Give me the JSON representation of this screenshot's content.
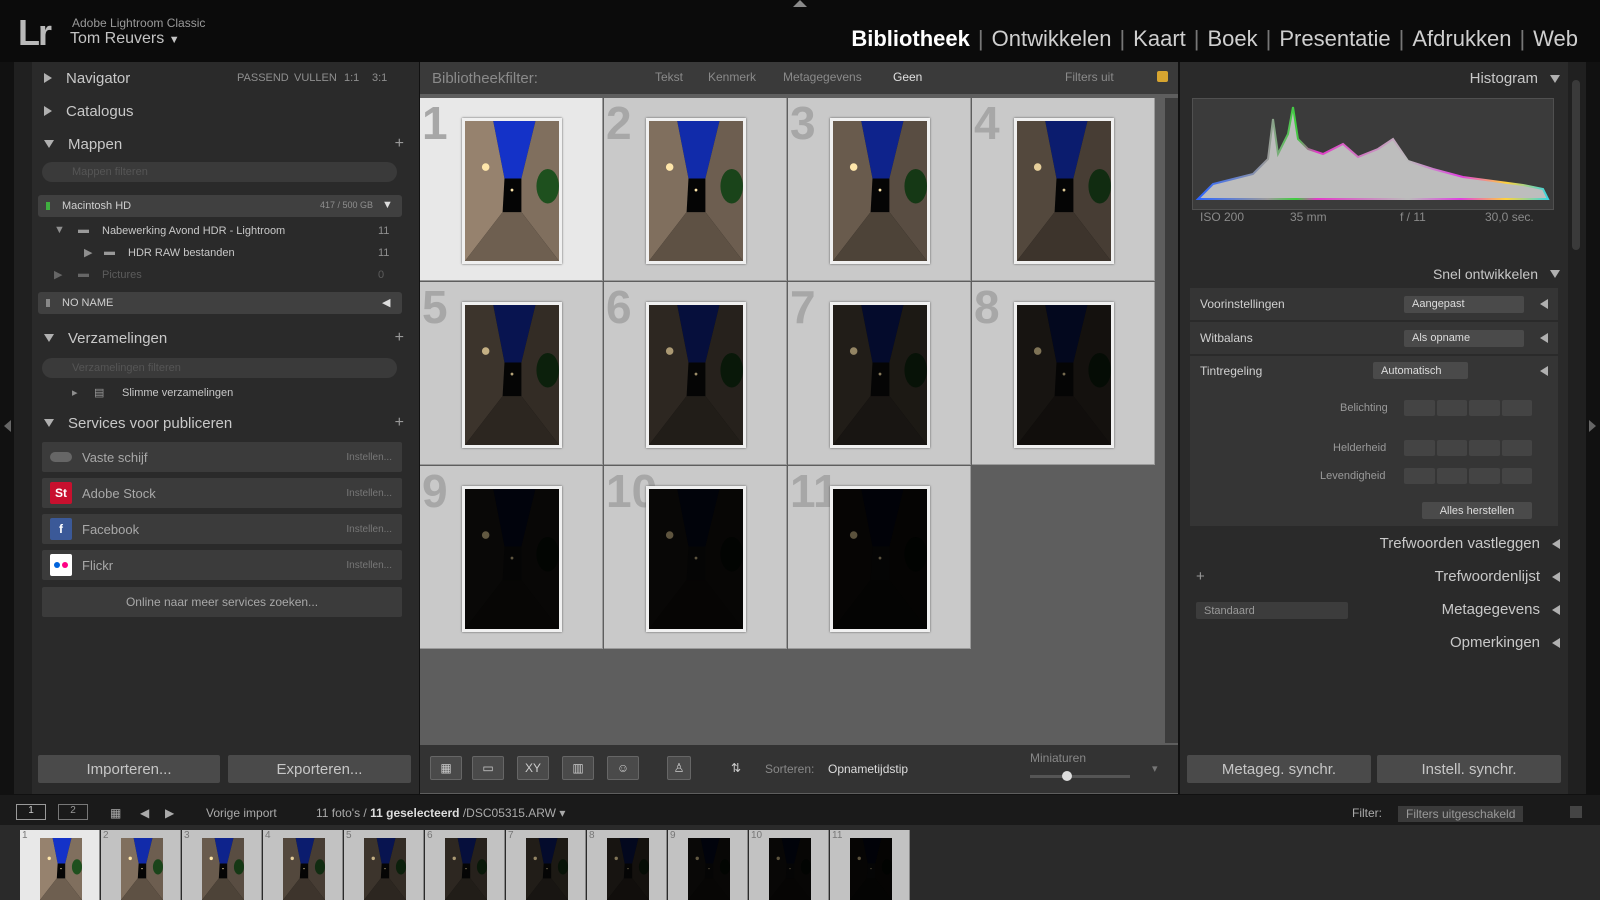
{
  "app": {
    "logo": "Lr",
    "name": "Adobe Lightroom Classic",
    "user": "Tom Reuvers",
    "user_caret": "▼"
  },
  "modules": [
    {
      "label": "Bibliotheek",
      "active": true
    },
    {
      "label": "Ontwikkelen"
    },
    {
      "label": "Kaart"
    },
    {
      "label": "Boek"
    },
    {
      "label": "Presentatie"
    },
    {
      "label": "Afdrukken"
    },
    {
      "label": "Web"
    }
  ],
  "left": {
    "navigator": {
      "label": "Navigator",
      "opts": [
        "PASSEND",
        "VULLEN",
        "1:1",
        "3:1"
      ]
    },
    "catalogus": "Catalogus",
    "mappen": {
      "label": "Mappen",
      "search_placeholder": "Mappen filteren",
      "volume": {
        "name": "Macintosh HD",
        "size": "417 / 500 GB"
      },
      "folders": [
        {
          "name": "Nabewerking Avond HDR - Lightroom",
          "count": "11"
        },
        {
          "name": "HDR RAW bestanden",
          "count": "11"
        },
        {
          "name": "Pictures",
          "count": "0"
        }
      ],
      "no_name": "NO NAME"
    },
    "verzamelingen": {
      "label": "Verzamelingen",
      "search_placeholder": "Verzamelingen filteren",
      "item": "Slimme verzamelingen"
    },
    "publish": {
      "label": "Services voor publiceren",
      "services": [
        {
          "name": "Vaste schijf",
          "action": "Instellen..."
        },
        {
          "name": "Adobe Stock",
          "action": "Instellen..."
        },
        {
          "name": "Facebook",
          "action": "Instellen..."
        },
        {
          "name": "Flickr",
          "action": "Instellen..."
        }
      ],
      "find_more": "Online naar meer services zoeken..."
    },
    "import_btn": "Importeren...",
    "export_btn": "Exporteren..."
  },
  "filterbar": {
    "label": "Bibliotheekfilter:",
    "tabs": [
      "Tekst",
      "Kenmerk",
      "Metagegevens",
      "Geen"
    ],
    "active": "Geen",
    "filters_off": "Filters uit"
  },
  "grid": {
    "photos": [
      {
        "num": "1",
        "b": 1.0
      },
      {
        "num": "2",
        "b": 0.85
      },
      {
        "num": "3",
        "b": 0.7
      },
      {
        "num": "4",
        "b": 0.55
      },
      {
        "num": "5",
        "b": 0.4
      },
      {
        "num": "6",
        "b": 0.3
      },
      {
        "num": "7",
        "b": 0.22
      },
      {
        "num": "8",
        "b": 0.15
      },
      {
        "num": "9",
        "b": 0.06
      },
      {
        "num": "10",
        "b": 0.05
      },
      {
        "num": "11",
        "b": 0.04
      }
    ]
  },
  "toolbar": {
    "sort_label": "Sorteren:",
    "sort_value": "Opnametijdstip",
    "thumbs_label": "Miniaturen"
  },
  "right": {
    "histogram": "Histogram",
    "exif": {
      "iso": "ISO 200",
      "focal": "35 mm",
      "aperture": "f / 11",
      "shutter": "30,0 sec."
    },
    "quick_develop": "Snel ontwikkelen",
    "presets": {
      "label": "Voorinstellingen",
      "value": "Aangepast"
    },
    "wb": {
      "label": "Witbalans",
      "value": "Als opname"
    },
    "tone": {
      "label": "Tintregeling",
      "value": "Automatisch"
    },
    "exposure": "Belichting",
    "clarity": "Helderheid",
    "vibrance": "Levendigheid",
    "reset": "Alles herstellen",
    "keywording": "Trefwoorden vastleggen",
    "keyword_list": "Trefwoordenlijst",
    "metadata": {
      "label": "Metagegevens",
      "preset": "Standaard"
    },
    "comments": "Opmerkingen",
    "sync_meta": "Metageg. synchr.",
    "sync_settings": "Instell. synchr."
  },
  "filmstrip": {
    "screens": [
      "1",
      "2"
    ],
    "source": "Vorige import",
    "count_prefix": "11 foto's / ",
    "count_selected": "11 geselecteerd",
    "file": " /DSC05315.ARW ▾",
    "filter_label": "Filter:",
    "filter_value": "Filters uitgeschakeld"
  }
}
